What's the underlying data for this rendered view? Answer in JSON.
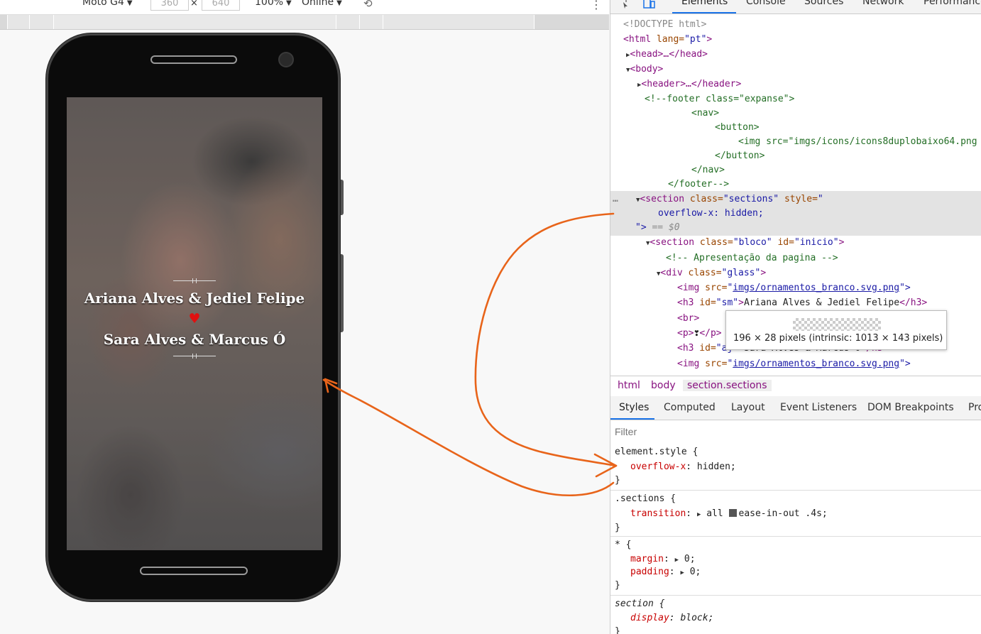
{
  "device_toolbar": {
    "device": "Moto G4",
    "width": "360",
    "times": "×",
    "height": "640",
    "zoom": "100%",
    "network": "Online",
    "more": "⋮"
  },
  "phone_screen": {
    "name1": "Ariana Alves & Jediel Felipe",
    "heart": "♥",
    "name2": "Sara Alves & Marcus Ó"
  },
  "devtools": {
    "tabs": [
      "Elements",
      "Console",
      "Sources",
      "Network",
      "Performance"
    ],
    "dom_lines": {
      "doctype": "<!DOCTYPE html>",
      "html_open": "<html",
      "html_lang_attr": " lang=",
      "html_lang_val": "\"pt\"",
      "html_close": ">",
      "head": "<head>…</head>",
      "body": "<body>",
      "header": "<header>…</header>",
      "c1": "<!--footer class=\"expanse\">",
      "c2": "<nav>",
      "c3": "<button>",
      "c4": "<img src=\"imgs/icons/icons8duplobaixo64.png",
      "c5": "</button>",
      "c6": "</nav>",
      "c7": "</footer-->",
      "dots": "…",
      "sec_tag": "<section",
      "sec_class_attr": " class=",
      "sec_class_val": "\"sections\"",
      "sec_style_attr": " style=",
      "sec_style_open": "\"",
      "sec_style_body": "overflow-x: hidden;",
      "sec_style_close": "\">",
      "sec_eq": " == $0",
      "bloco_tag": "<section",
      "bloco_class_attr": " class=",
      "bloco_class_val": "\"bloco\"",
      "bloco_id_attr": " id=",
      "bloco_id_val": "\"inicio\"",
      "bloco_close": ">",
      "comment": "<!-- Apresentação da pagina -->",
      "div_tag": "<div",
      "div_class_attr": " class=",
      "div_class_val": "\"glass\"",
      "div_close": ">",
      "img1_tag": "<img",
      "img_src_attr": " src=",
      "img_src_q": "\"",
      "img1_src": "imgs/ornamentos_branco.svg.png",
      "img_close": "\">",
      "h3_tag": "<h3",
      "h3_id_attr": " id=",
      "h3_id_val": "\"sm\"",
      "h3_text": "Ariana Alves & Jediel Felipe",
      "h3_end": "</h3>",
      "br": "<br>",
      "p_open": "<p>",
      "p_heart": "❣",
      "p_close": "</p>",
      "h3b_tag": "<h3",
      "h3b_id_attr": " id=",
      "h3b_id_val": "\"aj\"",
      "h3b_text": "Sara Alves & Marcus Ó",
      "h3b_end": "</h3>",
      "img2_src": "imgs/ornamentos_branco.svg.png"
    },
    "tooltip": "196 × 28 pixels (intrinsic: 1013 × 143 pixels)",
    "breadcrumbs": [
      "html",
      "body",
      "section.sections"
    ],
    "subtabs": [
      "Styles",
      "Computed",
      "Layout",
      "Event Listeners",
      "DOM Breakpoints",
      "Pro"
    ],
    "filter_placeholder": "Filter",
    "styles": {
      "r1_sel": "element.style {",
      "r1_prop": "overflow-x",
      "r1_val": ": hidden;",
      "close": "}",
      "r2_sel": ".sections {",
      "r2_prop": "transition",
      "r2_val1": ": ",
      "r2_val2": "all ",
      "r2_val3": "ease-in-out .4s;",
      "r3_sel": "* {",
      "r3_prop1": "margin",
      "r3_val1": ": ",
      "r3_num": "0;",
      "r3_prop2": "padding",
      "r4_sel": "section {",
      "r4_prop": "display",
      "r4_val": ": block;"
    }
  },
  "colors": {
    "annotation": "#e8641a",
    "tag": "#881280",
    "attr": "#994500",
    "value": "#1a1aa6",
    "comment": "#236e25",
    "selected_row": "#e3e3e3",
    "accent": "#1a73e8"
  }
}
